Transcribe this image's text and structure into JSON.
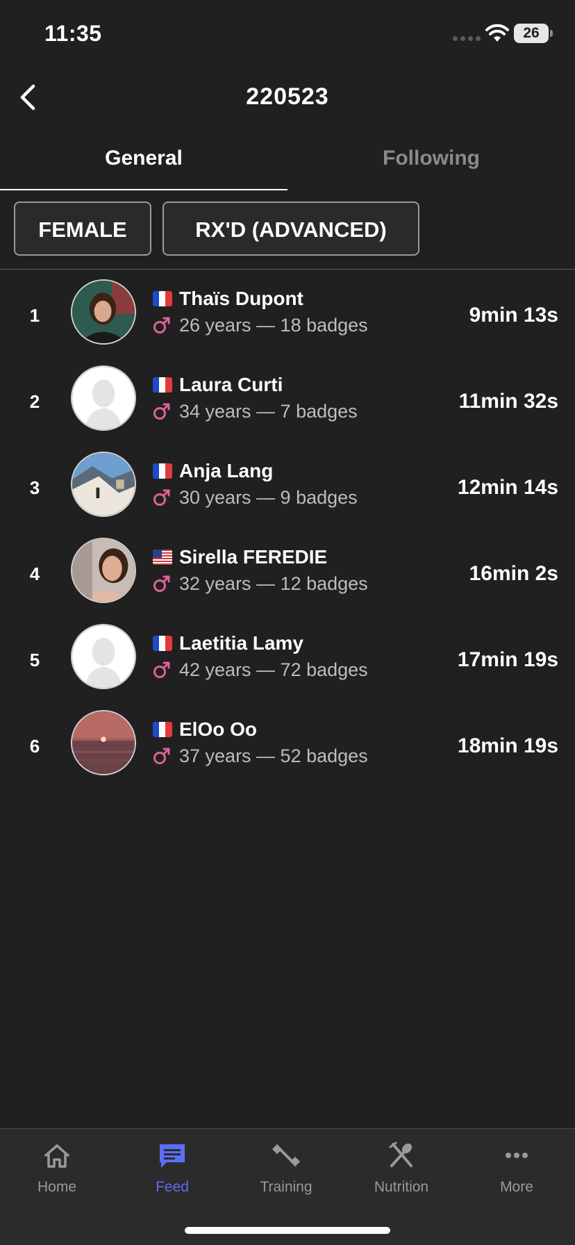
{
  "status_bar": {
    "time": "11:35",
    "battery_level": "26"
  },
  "header": {
    "title": "220523",
    "back_icon": "chevron-left-icon"
  },
  "tabs": [
    {
      "label": "General",
      "active": true
    },
    {
      "label": "Following",
      "active": false
    }
  ],
  "filters": {
    "gender": "FEMALE",
    "level": "RX'D (ADVANCED)"
  },
  "leaderboard": [
    {
      "rank": "1",
      "flag": "fr",
      "name": "Thaïs Dupont",
      "meta": "26 years — 18 badges",
      "score": "9min 13s",
      "avatar": "photo-woman-portrait"
    },
    {
      "rank": "2",
      "flag": "fr",
      "name": "Laura Curti",
      "meta": "34 years — 7 badges",
      "score": "11min 32s",
      "avatar": "default-silhouette"
    },
    {
      "rank": "3",
      "flag": "fr",
      "name": "Anja Lang",
      "meta": "30 years — 9 badges",
      "score": "12min 14s",
      "avatar": "photo-outdoor-landscape"
    },
    {
      "rank": "4",
      "flag": "us",
      "name": "Sirella FEREDIE",
      "meta": "32 years — 12 badges",
      "score": "16min 2s",
      "avatar": "photo-woman-selfie"
    },
    {
      "rank": "5",
      "flag": "fr",
      "name": "Laetitia Lamy",
      "meta": "42 years — 72 badges",
      "score": "17min 19s",
      "avatar": "default-silhouette"
    },
    {
      "rank": "6",
      "flag": "fr",
      "name": "ElOo Oo",
      "meta": "37 years — 52 badges",
      "score": "18min 19s",
      "avatar": "photo-sunset"
    }
  ],
  "bottom_nav": [
    {
      "label": "Home",
      "icon": "home-icon",
      "active": false
    },
    {
      "label": "Feed",
      "icon": "feed-icon",
      "active": true
    },
    {
      "label": "Training",
      "icon": "dumbbell-icon",
      "active": false
    },
    {
      "label": "Nutrition",
      "icon": "fork-spoon-icon",
      "active": false
    },
    {
      "label": "More",
      "icon": "more-icon",
      "active": false
    }
  ],
  "colors": {
    "background": "#202020",
    "accent": "#5b6ef5",
    "gender_icon": "#e0609a",
    "muted_text": "#bdbdbd"
  }
}
